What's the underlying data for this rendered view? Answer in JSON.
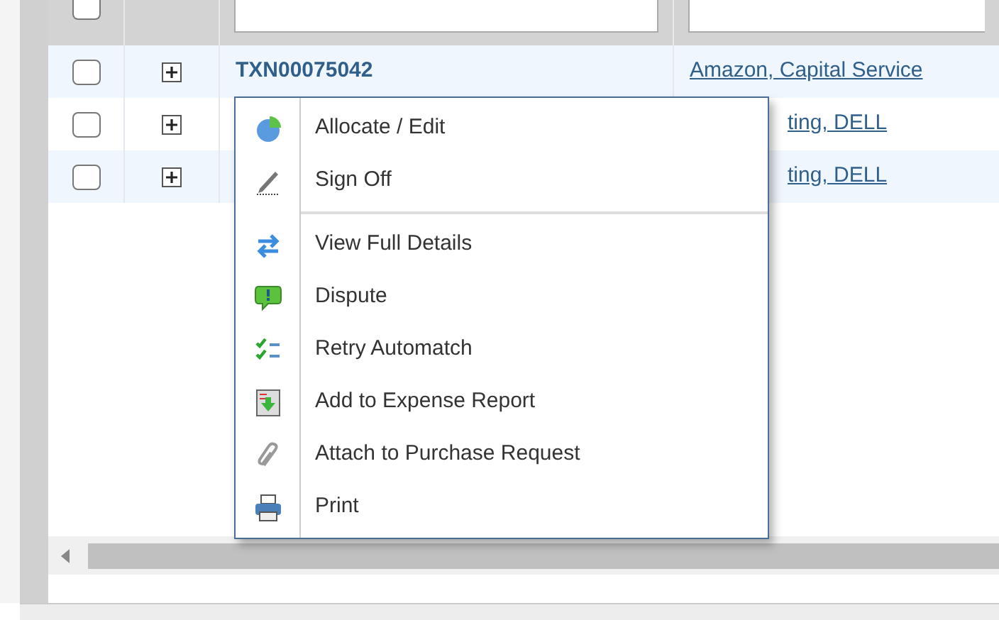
{
  "table": {
    "select_all_checked": false,
    "rows": [
      {
        "checked": false,
        "id": "TXN00075042",
        "vendor": "Amazon, Capital Service",
        "vendor_covered": false
      },
      {
        "checked": false,
        "vendor": "ting, DELL",
        "vendor_covered": true
      },
      {
        "checked": false,
        "vendor": "ting, DELL",
        "vendor_covered": true
      }
    ]
  },
  "context_menu": {
    "sections": [
      [
        {
          "kind": "pie",
          "label": "Allocate / Edit"
        },
        {
          "kind": "pen",
          "label": "Sign Off"
        }
      ],
      [
        {
          "kind": "arrows",
          "label": "View Full Details"
        },
        {
          "kind": "bubble",
          "label": "Dispute"
        },
        {
          "kind": "checklist",
          "label": "Retry Automatch"
        },
        {
          "kind": "report",
          "label": "Add to Expense Report"
        },
        {
          "kind": "clip",
          "label": "Attach to Purchase Request"
        },
        {
          "kind": "printer",
          "label": "Print"
        }
      ]
    ]
  }
}
